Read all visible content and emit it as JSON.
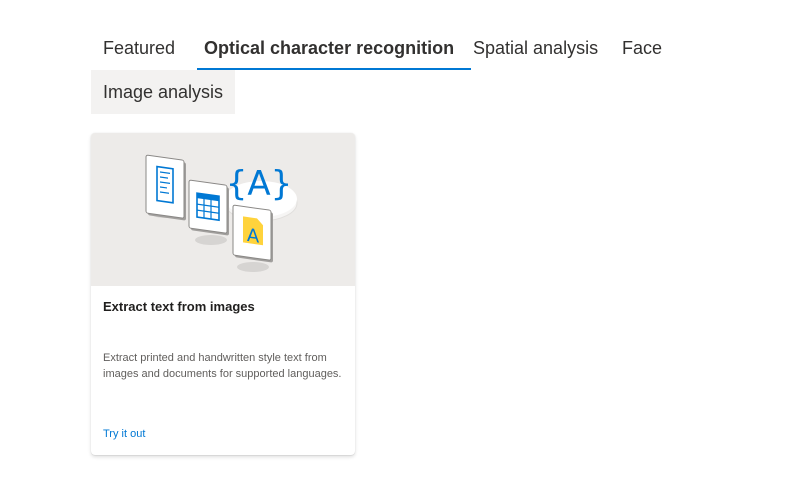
{
  "tabs": [
    {
      "label": "Featured",
      "selected": false
    },
    {
      "label": "Optical character recognition",
      "selected": true
    },
    {
      "label": "Spatial analysis",
      "selected": false
    },
    {
      "label": "Face",
      "selected": false
    },
    {
      "label": "Image analysis",
      "selected": false,
      "hovered": true
    }
  ],
  "card": {
    "title": "Extract text from images",
    "description": "Extract printed and handwritten style text from images and documents for supported languages.",
    "link_label": "Try it out",
    "illustration_glyph": "{A}",
    "badge_letter": "A"
  },
  "colors": {
    "accent": "#0078d4",
    "card_image_bg": "#edebe9",
    "hover_bg": "#f3f2f1",
    "badge_yellow": "#ffd33c"
  }
}
